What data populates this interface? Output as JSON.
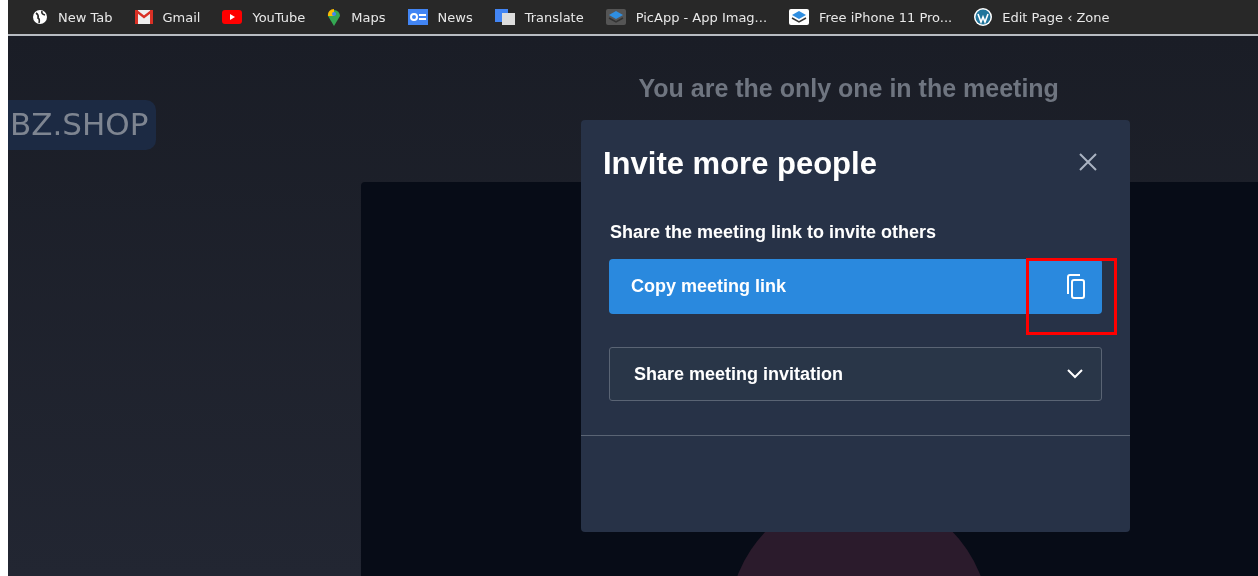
{
  "bookmarks": [
    {
      "label": "New Tab",
      "kind": "globe"
    },
    {
      "label": "Gmail",
      "kind": "mail"
    },
    {
      "label": "YouTube",
      "kind": "play"
    },
    {
      "label": "Maps",
      "kind": "pin"
    },
    {
      "label": "News",
      "kind": "news"
    },
    {
      "label": "Translate",
      "kind": "translate"
    },
    {
      "label": "PicApp - App Imag...",
      "kind": "layers-grey"
    },
    {
      "label": "Free iPhone 11 Pro...",
      "kind": "layers-blue"
    },
    {
      "label": "Edit Page ‹ Zone",
      "kind": "wp"
    }
  ],
  "logo": "BZ.SHOP",
  "meeting_status": "You are the only one in the meeting",
  "dialog": {
    "title": "Invite more people",
    "section_label": "Share the meeting link to invite others",
    "copy_button": "Copy meeting link",
    "share_dropdown": {
      "label": "Share meeting invitation",
      "expanded": false
    }
  }
}
